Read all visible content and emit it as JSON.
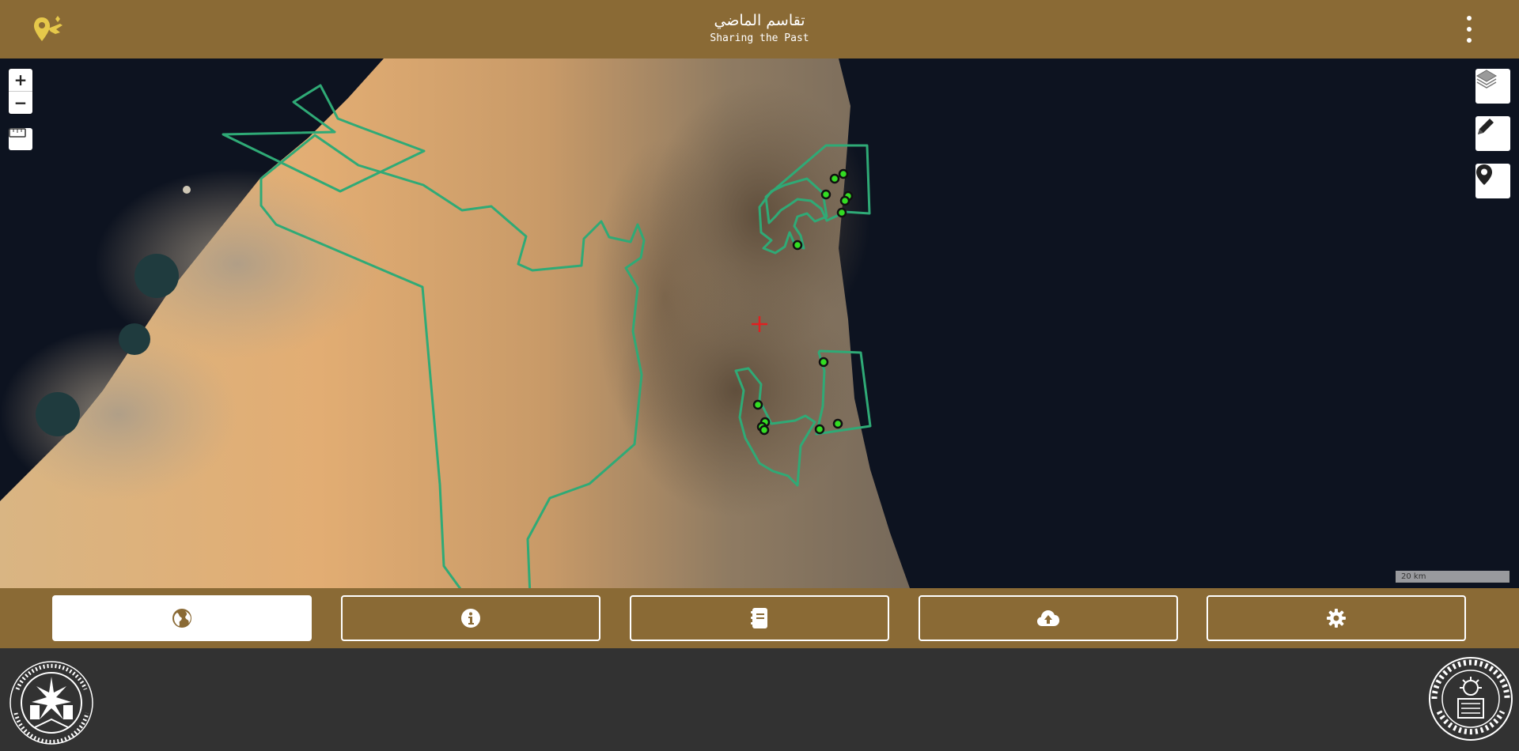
{
  "header": {
    "title_ar": "تقاسم الماضي",
    "title_en": "Sharing the Past",
    "logo_icon": "pin-with-hand-icon",
    "menu_icon": "kebab-menu-icon"
  },
  "map": {
    "zoom_in_label": "+",
    "zoom_out_label": "−",
    "scale_label": "20 km",
    "controls": [
      "layers-icon",
      "pencil-icon",
      "map-marker-icon",
      "measure-ruler-icon",
      "crosshair-icon"
    ]
  },
  "nav": {
    "items": [
      {
        "icon": "globe-icon",
        "active": true
      },
      {
        "icon": "info-icon",
        "active": false
      },
      {
        "icon": "book-icon",
        "active": false
      },
      {
        "icon": "cloud-upload-icon",
        "active": false
      },
      {
        "icon": "gear-icon",
        "active": false
      }
    ]
  },
  "footer": {
    "left_seal_text": "حكومة الشارقة - هيئة الشارقة للآثار · Sharjah Archaeology Authority · Govt. of Sharjah",
    "right_seal_text": "UNIVERSIDAD POLITÉCNICA MADRID"
  },
  "colors": {
    "brand": "#8a6a35",
    "footer": "#323232",
    "boundary": "#2faa76",
    "site_marker": "#33dd22",
    "crosshair": "#e02020"
  }
}
